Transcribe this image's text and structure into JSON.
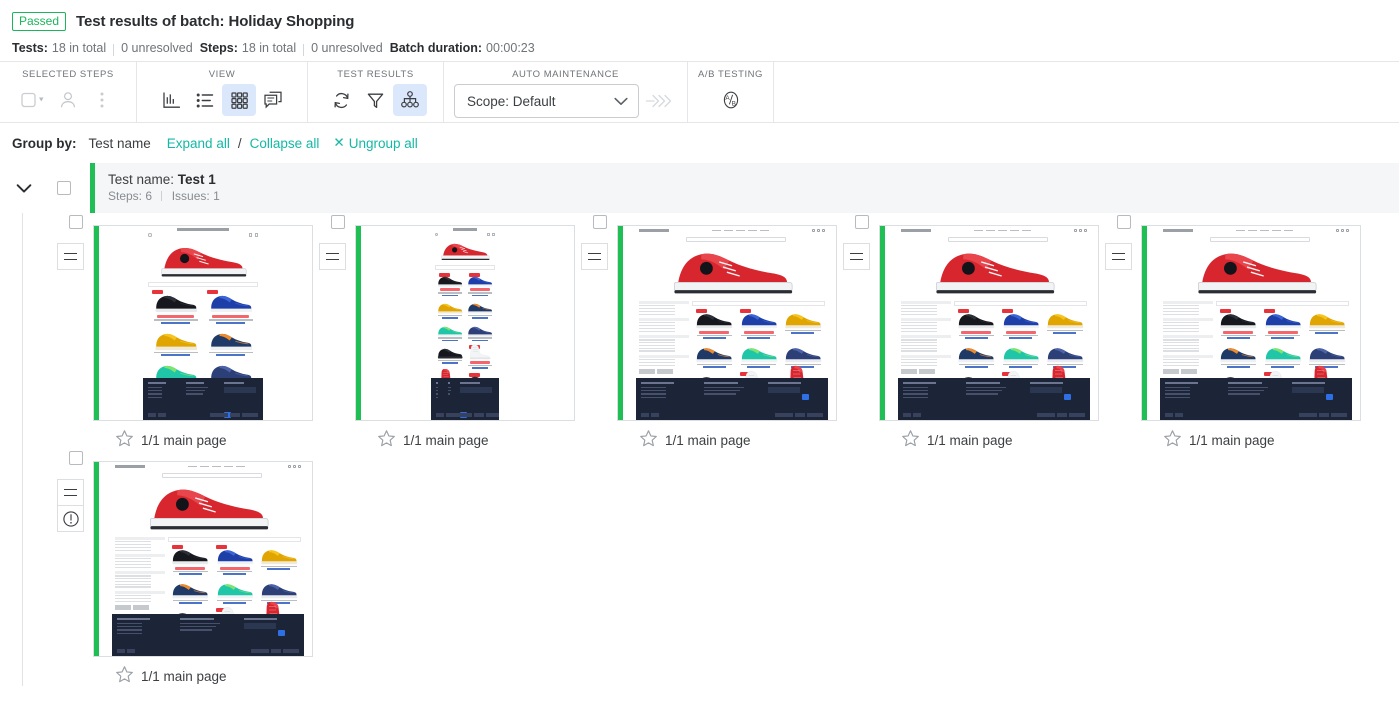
{
  "header": {
    "status_badge": "Passed",
    "title": "Test results of batch: Holiday Shopping",
    "meta": {
      "tests_label": "Tests:",
      "tests_total": "18 in total",
      "tests_unresolved": "0 unresolved",
      "steps_label": "Steps:",
      "steps_total": "18 in total",
      "steps_unresolved": "0 unresolved",
      "duration_label": "Batch duration:",
      "duration_value": "00:00:23"
    }
  },
  "toolbar": {
    "groups": [
      {
        "label": "SELECTED STEPS"
      },
      {
        "label": "VIEW"
      },
      {
        "label": "TEST RESULTS"
      },
      {
        "label": "AUTO MAINTENANCE"
      },
      {
        "label": "A/B TESTING"
      }
    ],
    "scope_select": {
      "value": "Scope: Default"
    }
  },
  "groupby": {
    "label": "Group by:",
    "value": "Test name",
    "expand_all": "Expand all",
    "slash": "/",
    "collapse_all": "Collapse all",
    "ungroup_all": "Ungroup all",
    "ungroup_x": "✕"
  },
  "group": {
    "title_prefix": "Test name: ",
    "title_name": "Test 1",
    "steps_label": "Steps: 6",
    "issues_label": "Issues: 1"
  },
  "colors": {
    "accent_teal": "#14b8a6",
    "status_green": "#1bb55c",
    "bar_green": "#20bf55",
    "active_blue": "#dbe7fb"
  },
  "thumbnails": [
    {
      "caption": "1/1 main page",
      "layout": "narrow",
      "has_issue": false
    },
    {
      "caption": "1/1 main page",
      "layout": "tiny",
      "has_issue": false
    },
    {
      "caption": "1/1 main page",
      "layout": "wide",
      "has_issue": false
    },
    {
      "caption": "1/1 main page",
      "layout": "wide",
      "has_issue": false
    },
    {
      "caption": "1/1 main page",
      "layout": "wide",
      "has_issue": false
    },
    {
      "caption": "1/1 main page",
      "layout": "wide",
      "has_issue": true
    }
  ]
}
